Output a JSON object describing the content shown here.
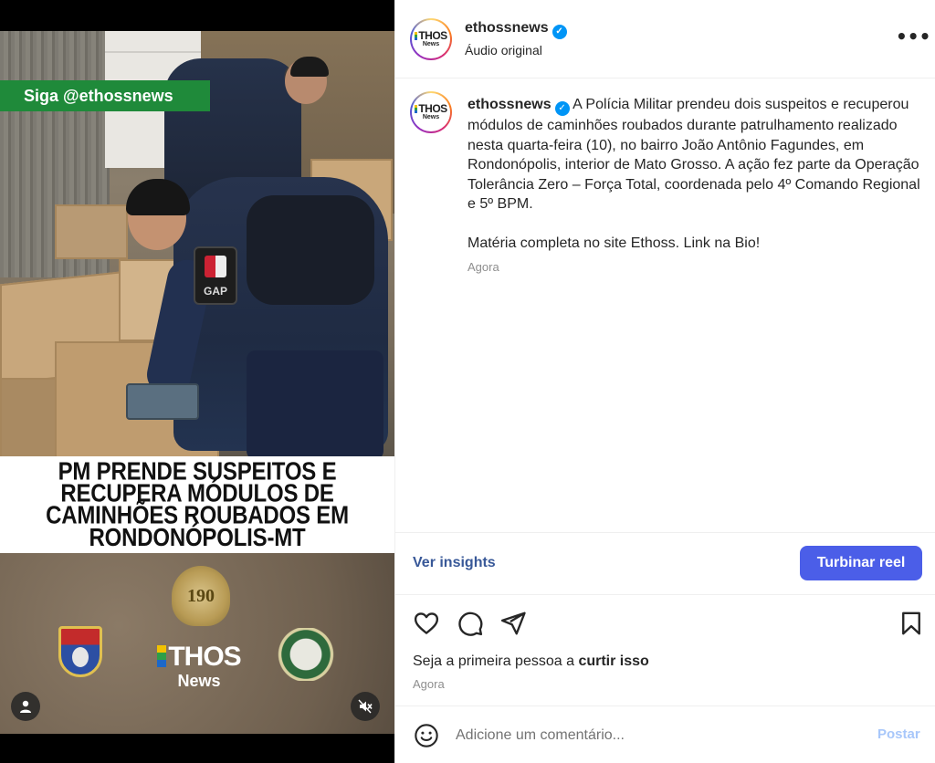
{
  "media": {
    "follow_banner": "Siga @ethossnews",
    "headline_lines": [
      "PM PRENDE SUSPEITOS E",
      "RECUPERA MÓDULOS DE",
      "CAMINHÕES ROUBADOS EM",
      "RONDONÓPOLIS-MT"
    ],
    "vest_patch": "GAP",
    "badge_190": "190",
    "logo_word": "THOS",
    "logo_sub": "News"
  },
  "header": {
    "username": "ethossnews",
    "audio": "Áudio original",
    "more_label": "•••"
  },
  "avatar": {
    "word": "THOS",
    "sub": "News"
  },
  "caption": {
    "username": "ethossnews",
    "text": "A Polícia Militar prendeu dois suspeitos e recuperou módulos de caminhões roubados durante patrulhamento realizado nesta quarta-feira (10), no bairro João Antônio Fagundes, em Rondonópolis, interior de Mato Grosso. A ação fez parte da Operação Tolerância Zero – Força Total, coordenada pelo 4º Comando Regional e 5º BPM.",
    "text2": "Matéria completa no site Ethoss. Link na Bio!",
    "time": "Agora"
  },
  "insights": {
    "link": "Ver insights",
    "boost": "Turbinar reel"
  },
  "likes": {
    "prefix": "Seja a primeira pessoa a ",
    "cta": "curtir isso",
    "time": "Agora"
  },
  "comment": {
    "placeholder": "Adicione um comentário...",
    "post": "Postar"
  },
  "icons": {
    "like": "heart-icon",
    "comment": "comment-icon",
    "share": "send-icon",
    "save": "bookmark-icon",
    "emoji": "emoji-icon",
    "user_tag": "user-icon",
    "mute": "muted-speaker-icon",
    "verified": "verified-badge-icon"
  },
  "colors": {
    "boost_button": "#4b5ee8",
    "link": "#385898",
    "verified": "#0095f6",
    "follow_banner": "#1f8a3a",
    "post_disabled": "#a8c7fa"
  }
}
